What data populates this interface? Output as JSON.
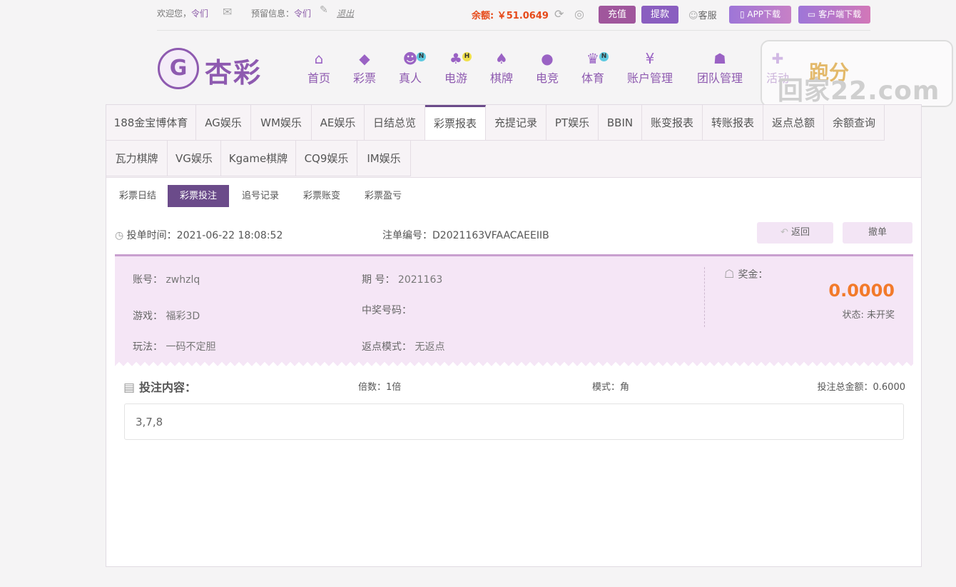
{
  "topbar": {
    "welcome": "欢迎您，",
    "username": "令们",
    "reserve_label": "预留信息：",
    "reserve_value": "令们",
    "logout": "退出",
    "balance_label": "余额:",
    "balance_value": "￥51.0649",
    "recharge": "充值",
    "withdraw": "提款",
    "service": "客服",
    "app_download": "APP下载",
    "client_download": "客户端下载"
  },
  "logo": {
    "mark": "G",
    "name": "杏彩"
  },
  "nav": [
    {
      "label": "首页",
      "icon": "home-icon",
      "glyph": "⌂",
      "badge": ""
    },
    {
      "label": "彩票",
      "icon": "ticket-icon",
      "glyph": "◆",
      "badge": ""
    },
    {
      "label": "真人",
      "icon": "dealer-icon",
      "glyph": "☻",
      "badge": "N"
    },
    {
      "label": "电游",
      "icon": "gamepad-icon",
      "glyph": "♣",
      "badge": "H"
    },
    {
      "label": "棋牌",
      "icon": "cards-icon",
      "glyph": "♠",
      "badge": ""
    },
    {
      "label": "电竞",
      "icon": "joystick-icon",
      "glyph": "●",
      "badge": ""
    },
    {
      "label": "体育",
      "icon": "trophy-icon",
      "glyph": "♛",
      "badge": "N"
    },
    {
      "label": "账户管理",
      "icon": "yen-icon",
      "glyph": "¥",
      "badge": ""
    },
    {
      "label": "团队管理",
      "icon": "team-icon",
      "glyph": "☗",
      "badge": ""
    },
    {
      "label": "活动",
      "icon": "gift-icon",
      "glyph": "✚",
      "badge": ""
    }
  ],
  "watermark": {
    "text": "回家22.com",
    "accent": "跑分"
  },
  "tabs_row1": [
    "188金宝博体育",
    "AG娱乐",
    "WM娱乐",
    "AE娱乐",
    "日结总览",
    "彩票报表",
    "充提记录",
    "PT娱乐",
    "BBIN",
    "账变报表",
    "转账报表",
    "返点总额",
    "余额查询"
  ],
  "tabs_row2": [
    "瓦力棋牌",
    "VG娱乐",
    "Kgame棋牌",
    "CQ9娱乐",
    "IM娱乐"
  ],
  "subnav": [
    "彩票日结",
    "彩票投注",
    "追号记录",
    "彩票账变",
    "彩票盈亏"
  ],
  "order": {
    "time_label": "投单时间：",
    "time_value": "2021-06-22 18:08:52",
    "id_label": "注单编号：",
    "id_value": "D2021163VFAACAEEIIB",
    "back": "返回",
    "cancel": "撤单"
  },
  "details": {
    "account_label": "账号：",
    "account_value": "zwhzlq",
    "issue_label": "期 号：",
    "issue_value": "2021163",
    "game_label": "游戏：",
    "game_value": "福彩3D",
    "winning_label": "中奖号码：",
    "winning_value": "",
    "play_label": "玩法：",
    "play_value": "一码不定胆",
    "rebate_label": "返点模式：",
    "rebate_value": "无返点",
    "prize_label": "奖金：",
    "prize_value": "0.0000",
    "status": "状态: 未开奖"
  },
  "bet": {
    "title": "投注内容：",
    "multiple": "倍数：1倍",
    "mode": "模式：角",
    "total": "投注总金额：0.6000",
    "content": "3,7,8"
  },
  "colors": {
    "accent": "#6b4b8a",
    "prize": "#f27a2a",
    "balance": "#e64a19"
  }
}
